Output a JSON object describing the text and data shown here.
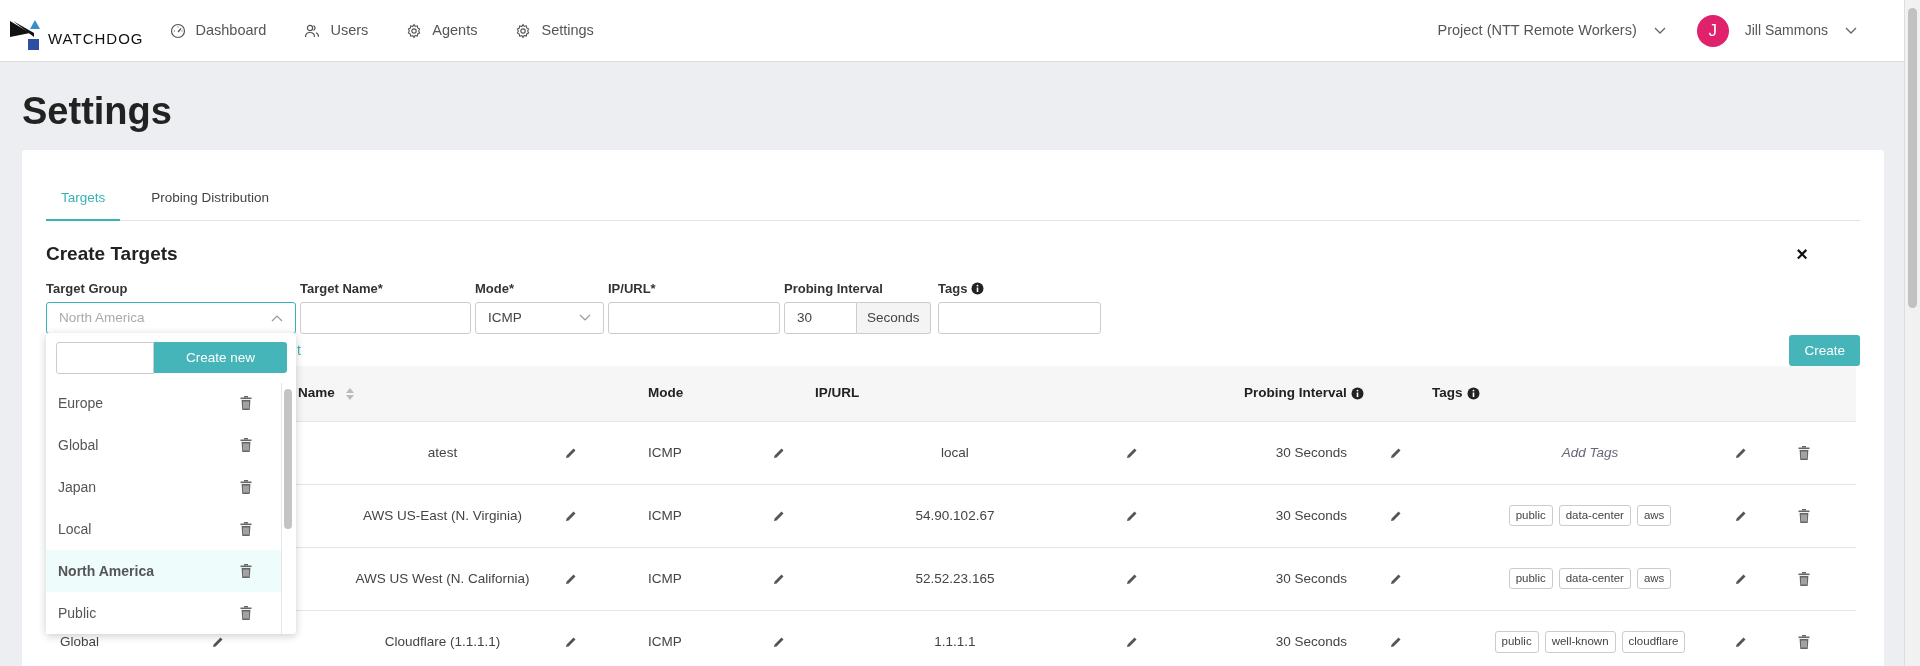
{
  "nav": {
    "brand": "WATCHDOG",
    "items": [
      {
        "label": "Dashboard"
      },
      {
        "label": "Users"
      },
      {
        "label": "Agents"
      },
      {
        "label": "Settings"
      }
    ],
    "project": "Project (NTT Remote Workers)",
    "user": {
      "initial": "J",
      "name": "Jill Sammons"
    }
  },
  "page_title": "Settings",
  "tabs": [
    {
      "label": "Targets",
      "selected": true
    },
    {
      "label": "Probing Distribution",
      "selected": false
    }
  ],
  "form": {
    "title": "Create Targets",
    "close": "×",
    "fields": [
      {
        "label": "Target Group",
        "kind": "select",
        "placeholder": "North America",
        "open": true
      },
      {
        "label": "Target Name*",
        "kind": "text"
      },
      {
        "label": "Mode*",
        "kind": "select",
        "value": "ICMP"
      },
      {
        "label": "IP/URL*",
        "kind": "text"
      },
      {
        "label": "Probing Interval",
        "kind": "interval",
        "value": "30",
        "unit": "Seconds"
      },
      {
        "label": "Tags",
        "kind": "text",
        "info": true
      }
    ],
    "link": "t",
    "create_button": "Create"
  },
  "dropdown": {
    "button": "Create new",
    "options": [
      {
        "label": "Europe",
        "selected": false
      },
      {
        "label": "Global",
        "selected": false
      },
      {
        "label": "Japan",
        "selected": false
      },
      {
        "label": "Local",
        "selected": false
      },
      {
        "label": "North America",
        "selected": true
      },
      {
        "label": "Public",
        "selected": false
      }
    ]
  },
  "table": {
    "columns": [
      {
        "label": "Name",
        "sortable": true
      },
      {
        "label": "Mode"
      },
      {
        "label": "IP/URL"
      },
      {
        "label": "Probing Interval",
        "info": true
      },
      {
        "label": "Tags",
        "info": true
      }
    ],
    "rows": [
      {
        "name": "atest",
        "mode": "ICMP",
        "ip": "local",
        "interval": "30 Seconds",
        "tags_placeholder": "Add Tags"
      },
      {
        "name": "AWS US-East (N. Virginia)",
        "mode": "ICMP",
        "ip": "54.90.102.67",
        "interval": "30 Seconds",
        "tags": [
          "public",
          "data-center",
          "aws"
        ]
      },
      {
        "name": "AWS US West (N. California)",
        "mode": "ICMP",
        "ip": "52.52.23.165",
        "interval": "30 Seconds",
        "tags": [
          "public",
          "data-center",
          "aws"
        ]
      },
      {
        "group": "Global",
        "name": "Cloudflare (1.1.1.1)",
        "mode": "ICMP",
        "ip": "1.1.1.1",
        "interval": "30 Seconds",
        "tags": [
          "public",
          "well-known",
          "cloudflare"
        ]
      }
    ]
  }
}
